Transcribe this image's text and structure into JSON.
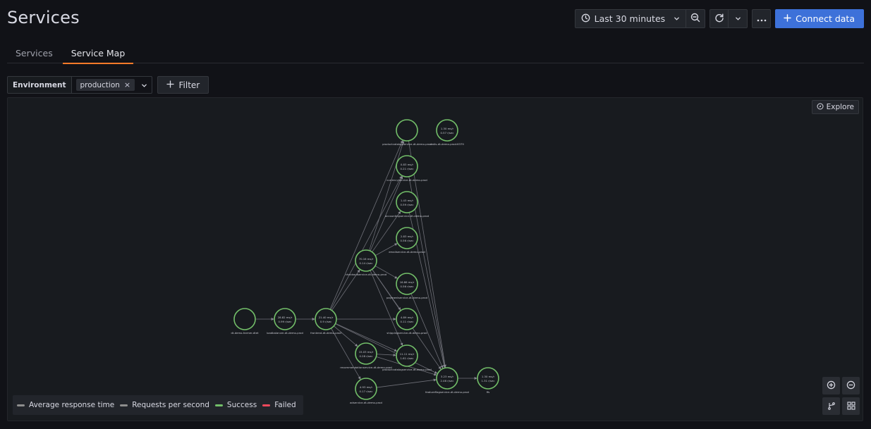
{
  "header": {
    "title": "Services",
    "time_range_label": "Last 30 minutes",
    "connect_label": "Connect data"
  },
  "tabs": [
    {
      "label": "Services"
    },
    {
      "label": "Service Map"
    }
  ],
  "filters": {
    "env_label": "Environment",
    "env_value": "production",
    "filter_label": "Filter"
  },
  "map": {
    "explore_label": "Explore",
    "legend": [
      {
        "label": "Average response time",
        "color": "#8e8e8e"
      },
      {
        "label": "Requests per second",
        "color": "#8e8e8e"
      },
      {
        "label": "Success",
        "color": "#73bf69"
      },
      {
        "label": "Failed",
        "color": "#f2495c"
      }
    ],
    "nodes": [
      {
        "id": "ext",
        "stat1": "",
        "stat2": "",
        "title": "dt-demo-farmer-dtet"
      },
      {
        "id": "lb",
        "stat1": "28.82 ms/r",
        "stat2": "0.99 r/sec",
        "title": "loadbalancer-dt-demo-prod"
      },
      {
        "id": "fe",
        "stat1": "21.40 ms/r",
        "stat2": "0.9 r/sec",
        "title": "frontend-dt-demo-prod"
      },
      {
        "id": "pc",
        "stat1": "",
        "stat2": "",
        "title": "productcatalogservice-dt-demo-prod"
      },
      {
        "id": "cur",
        "stat1": "0.83 ms/r",
        "stat2": "0.21 r/sec",
        "title": "currencyservice-dt-demo-prod"
      },
      {
        "id": "acc",
        "stat1": "1.43 ms/r",
        "stat2": "0.59 r/sec",
        "title": "accountingservice-dt-demo-prod"
      },
      {
        "id": "em",
        "stat1": "2.83 ms/r",
        "stat2": "0.56 r/sec",
        "title": "emailservice-dt-demo-prod"
      },
      {
        "id": "co",
        "stat1": "70.16 ms/r",
        "stat2": "0.14 r/sec",
        "title": "checkoutservice-dt-demo-prod"
      },
      {
        "id": "pay",
        "stat1": "16.86 ms/r",
        "stat2": "0.56 r/sec",
        "title": "paymentservice-dt-demo-prod"
      },
      {
        "id": "ship",
        "stat1": "4.89 ms/r",
        "stat2": "0.11 r/sec",
        "title": "shippingservice-dt-demo-prod"
      },
      {
        "id": "rec",
        "stat1": "15.03 ms/r",
        "stat2": "0.28 r/sec",
        "title": "recommendationservice-dt-demo-prod"
      },
      {
        "id": "pc2",
        "stat1": "11.11 ms/r",
        "stat2": "1.61 r/sec",
        "title": "productcatalogservice-dt-demo-prod"
      },
      {
        "id": "ad",
        "stat1": "4.93 ms/r",
        "stat2": "0.17 r/sec",
        "title": "adservice-dt-demo-prod"
      },
      {
        "id": "cart",
        "stat1": "3.23 ms/r",
        "stat2": "2.46 r/sec",
        "title": "featureflagservice-dt-demo-prod"
      },
      {
        "id": "redis",
        "stat1": "1.30 ms/r",
        "stat2": "1.31 r/sec",
        "title": "ffs"
      },
      {
        "id": "kafka",
        "stat1": "1.30 ms/r",
        "stat2": "0.57 r/sec",
        "title": "redis-dt-demo-prod:6379"
      }
    ]
  }
}
